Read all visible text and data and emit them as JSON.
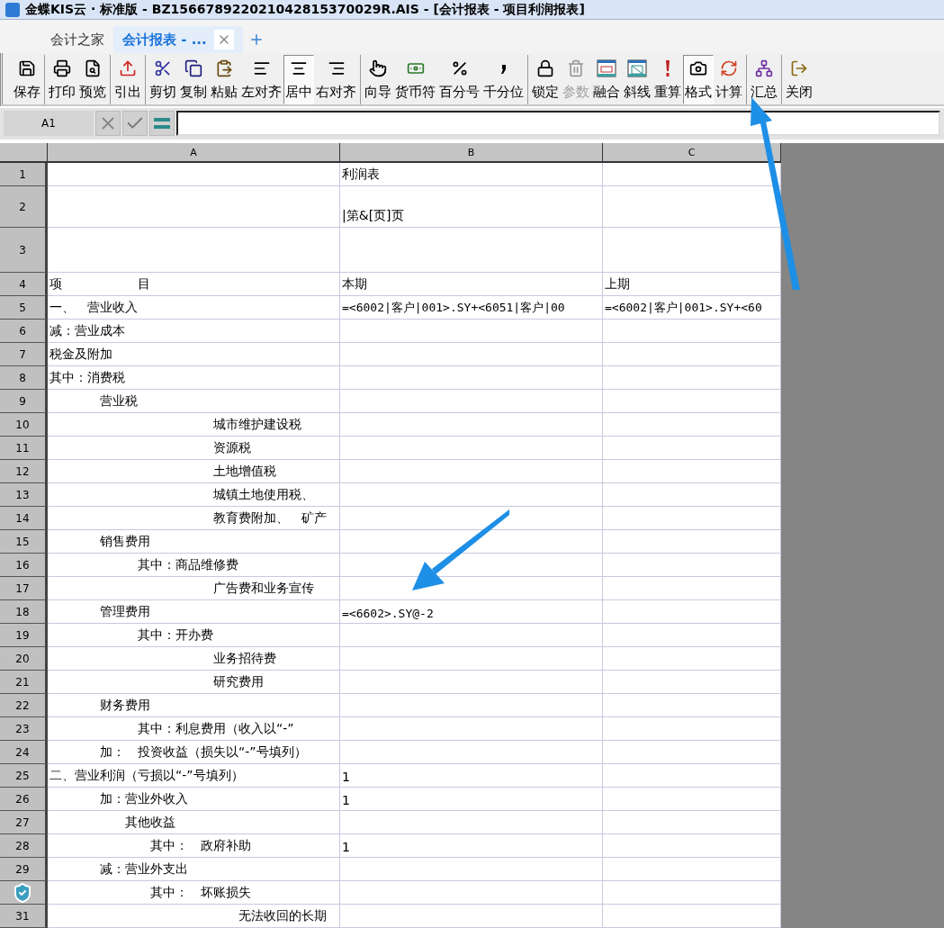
{
  "window": {
    "title": "金蝶KIS云 · 标准版 - BZ156678922021042815370029R.AIS - [会计报表 - 项目利润报表]"
  },
  "tabs": [
    {
      "label": "会计之家",
      "selected": false,
      "closable": false
    },
    {
      "label": "会计报表 - ...",
      "selected": true,
      "closable": true
    }
  ],
  "toolbar": {
    "groups": [
      [
        {
          "label": "保存",
          "pressed": false,
          "disabled": false
        }
      ],
      [
        {
          "label": "打印",
          "pressed": false,
          "disabled": false
        },
        {
          "label": "预览",
          "pressed": false,
          "disabled": false
        }
      ],
      [
        {
          "label": "引出",
          "pressed": false,
          "disabled": false
        }
      ],
      [
        {
          "label": "剪切",
          "pressed": false,
          "disabled": false
        },
        {
          "label": "复制",
          "pressed": false,
          "disabled": false
        },
        {
          "label": "粘贴",
          "pressed": false,
          "disabled": false
        },
        {
          "label": "左对齐",
          "pressed": false,
          "disabled": false
        },
        {
          "label": "居中",
          "pressed": true,
          "disabled": false
        },
        {
          "label": "右对齐",
          "pressed": false,
          "disabled": false
        }
      ],
      [
        {
          "label": "向导",
          "pressed": false,
          "disabled": false
        },
        {
          "label": "货币符",
          "pressed": false,
          "disabled": false
        },
        {
          "label": "百分号",
          "pressed": false,
          "disabled": false
        },
        {
          "label": "千分位",
          "pressed": false,
          "disabled": false
        }
      ],
      [
        {
          "label": "锁定",
          "pressed": false,
          "disabled": false
        },
        {
          "label": "参数",
          "pressed": false,
          "disabled": true
        },
        {
          "label": "融合",
          "pressed": false,
          "disabled": false
        },
        {
          "label": "斜线",
          "pressed": false,
          "disabled": false
        },
        {
          "label": "重算",
          "pressed": false,
          "disabled": false
        },
        {
          "label": "格式",
          "pressed": true,
          "disabled": false
        },
        {
          "label": "计算",
          "pressed": false,
          "disabled": false
        }
      ],
      [
        {
          "label": "汇总",
          "pressed": false,
          "disabled": false
        }
      ],
      [
        {
          "label": "关闭",
          "pressed": false,
          "disabled": false
        }
      ]
    ]
  },
  "formula_bar": {
    "cell_ref": "A1"
  },
  "sheet": {
    "columns": [
      "A",
      "B",
      "C"
    ],
    "rows": [
      {
        "number": "1",
        "cells": [
          "",
          "利润表",
          ""
        ]
      },
      {
        "number": "2",
        "cells": [
          "",
          "|第&[页]页",
          ""
        ]
      },
      {
        "number": "3",
        "cells": [
          "",
          "",
          ""
        ]
      },
      {
        "number": "4",
        "cells": [
          "项　　　　　　目",
          "本期",
          "上期"
        ]
      },
      {
        "number": "5",
        "cells": [
          "一、　营业收入",
          "=<6002|客户|001>.SY+<6051|客户|00",
          "=<6002|客户|001>.SY+<60"
        ]
      },
      {
        "number": "6",
        "cells": [
          "减：营业成本",
          "",
          ""
        ]
      },
      {
        "number": "7",
        "cells": [
          "税金及附加",
          "",
          ""
        ]
      },
      {
        "number": "8",
        "cells": [
          "其中：消费税",
          "",
          ""
        ]
      },
      {
        "number": "9",
        "cells": [
          "　　　　营业税",
          "",
          ""
        ]
      },
      {
        "number": "10",
        "cells": [
          "　　　　　　　　　　　　　城市维护建设税",
          "",
          ""
        ]
      },
      {
        "number": "11",
        "cells": [
          "　　　　　　　　　　　　　资源税",
          "",
          ""
        ]
      },
      {
        "number": "12",
        "cells": [
          "　　　　　　　　　　　　　土地增值税",
          "",
          ""
        ]
      },
      {
        "number": "13",
        "cells": [
          "　　　　　　　　　　　　　城镇土地使用税、",
          "",
          ""
        ]
      },
      {
        "number": "14",
        "cells": [
          "　　　　　　　　　　　　　教育费附加、　矿产",
          "",
          ""
        ]
      },
      {
        "number": "15",
        "cells": [
          "　　　　销售费用",
          "",
          ""
        ]
      },
      {
        "number": "16",
        "cells": [
          "　　　　　　　其中：商品维修费",
          "",
          ""
        ]
      },
      {
        "number": "17",
        "cells": [
          "　　　　　　　　　　　　　广告费和业务宣传",
          "",
          ""
        ]
      },
      {
        "number": "18",
        "cells": [
          "　　　　管理费用",
          "=<6602>.SY@-2",
          ""
        ]
      },
      {
        "number": "19",
        "cells": [
          "　　　　　　　其中：开办费",
          "",
          ""
        ]
      },
      {
        "number": "20",
        "cells": [
          "　　　　　　　　　　　　　业务招待费",
          "",
          ""
        ]
      },
      {
        "number": "21",
        "cells": [
          "　　　　　　　　　　　　　研究费用",
          "",
          ""
        ]
      },
      {
        "number": "22",
        "cells": [
          "　　　　财务费用",
          "",
          ""
        ]
      },
      {
        "number": "23",
        "cells": [
          "　　　　　　　其中：利息费用（收入以“-”",
          "",
          ""
        ]
      },
      {
        "number": "24",
        "cells": [
          "　　　　加：　投资收益（损失以“-”号填列）",
          "",
          ""
        ]
      },
      {
        "number": "25",
        "cells": [
          "二、营业利润（亏损以“-”号填列）",
          "1",
          ""
        ]
      },
      {
        "number": "26",
        "cells": [
          "　　　　加：营业外收入",
          "1",
          ""
        ]
      },
      {
        "number": "27",
        "cells": [
          "　　　　　　其他收益",
          "",
          ""
        ]
      },
      {
        "number": "28",
        "cells": [
          "　　　　　　　　其中：　政府补助",
          "1",
          ""
        ]
      },
      {
        "number": "29",
        "cells": [
          "　　　　减：营业外支出",
          "",
          ""
        ]
      },
      {
        "cells": [
          "　　　　　　　　其中：　坏账损失",
          "",
          ""
        ]
      },
      {
        "number": "31",
        "cells": [
          "　　　　　　　　　　　　　　　无法收回的长期",
          "",
          ""
        ]
      }
    ]
  }
}
